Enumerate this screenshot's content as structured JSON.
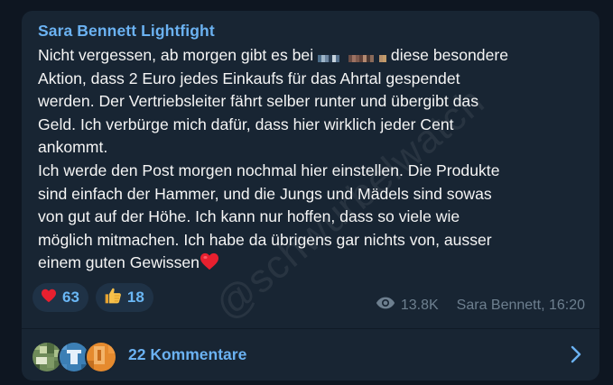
{
  "message": {
    "author": "Sara Bennett Lightfight",
    "lines": [
      "Nicht vergessen, ab morgen gibt es bei",
      "diese besondere",
      "Aktion, dass 2 Euro jedes Einkaufs für das Ahrtal gespendet",
      "werden. Der Vertriebsleiter fährt selber runter und übergibt das",
      "Geld. Ich verbürge mich dafür, dass hier wirklich jeder Cent",
      "ankommt.",
      "Ich werde den Post morgen nochmal hier einstellen. Die Produkte",
      "sind einfach der Hammer, und die Jungs und Mädels sind sowas",
      "von gut auf der Höhe. Ich kann nur hoffen, dass so viele wie",
      "möglich mitmachen. Ich habe da übrigens gar nichts von, ausser",
      "einem guten Gewissen"
    ],
    "end_emoji": "heart-emoji"
  },
  "reactions": [
    {
      "icon": "red-heart-icon",
      "count": "63"
    },
    {
      "icon": "thumbs-up-icon",
      "count": "18"
    }
  ],
  "meta": {
    "views": "13.8K",
    "signature": "Sara Bennett, 16:20"
  },
  "comments": {
    "label": "22 Kommentare"
  },
  "watermark": "@schwurbelwatch",
  "colors": {
    "background": "#0e1621",
    "bubble": "#182533",
    "accent": "#6bb2f2",
    "text": "#f5f5f5",
    "meta": "#6d7f8f"
  }
}
